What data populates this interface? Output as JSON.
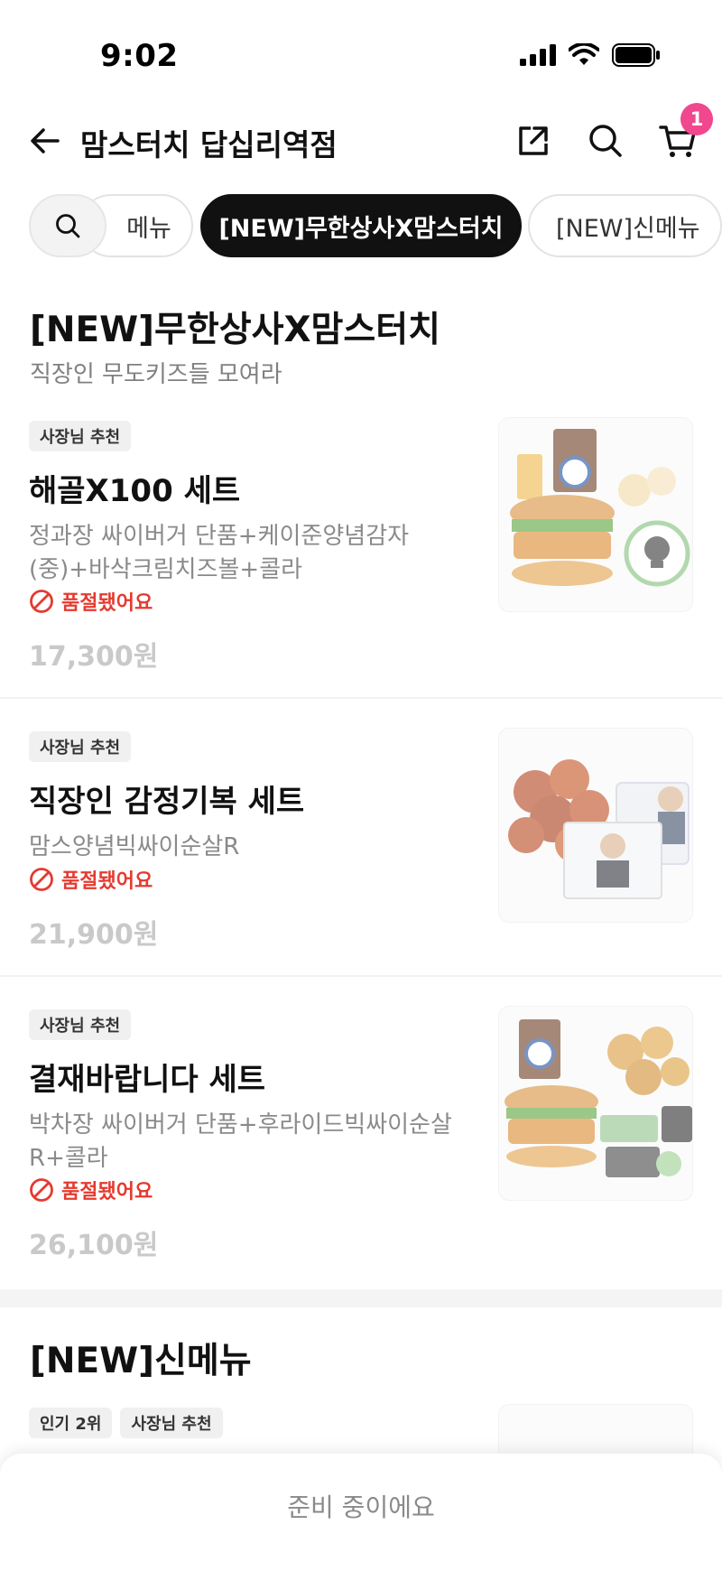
{
  "status_bar": {
    "time": "9:02"
  },
  "header": {
    "title": "맘스터치 답십리역점",
    "cart_count": "1"
  },
  "tabs": [
    "메뉴",
    "[NEW]무한상사X맘스터치",
    "[NEW]신메뉴"
  ],
  "sections": [
    {
      "title": "[NEW]무한상사X맘스터치",
      "subtitle": "직장인 무도키즈들 모여라",
      "items": [
        {
          "tags": [
            "사장님 추천"
          ],
          "name": "해골X100 세트",
          "desc": "정과장 싸이버거 단품+케이준양념감자(중)+바삭크림치즈볼+콜라",
          "status": "품절됐어요",
          "price": "17,300원"
        },
        {
          "tags": [
            "사장님 추천"
          ],
          "name": "직장인 감정기복 세트",
          "desc": "맘스양념빅싸이순살R",
          "status": "품절됐어요",
          "price": "21,900원"
        },
        {
          "tags": [
            "사장님 추천"
          ],
          "name": "결재바랍니다 세트",
          "desc": "박차장 싸이버거 단품+후라이드빅싸이순살R+콜라",
          "status": "품절됐어요",
          "price": "26,100원"
        }
      ]
    },
    {
      "title": "[NEW]신메뉴",
      "items": [
        {
          "tags": [
            "인기 2위",
            "사장님 추천"
          ]
        }
      ]
    }
  ],
  "bottom_sheet": {
    "text": "준비 중이에요"
  },
  "colors": {
    "accent_badge": "#f0478f",
    "soldout": "#e53a30",
    "active_tab": "#111111"
  }
}
